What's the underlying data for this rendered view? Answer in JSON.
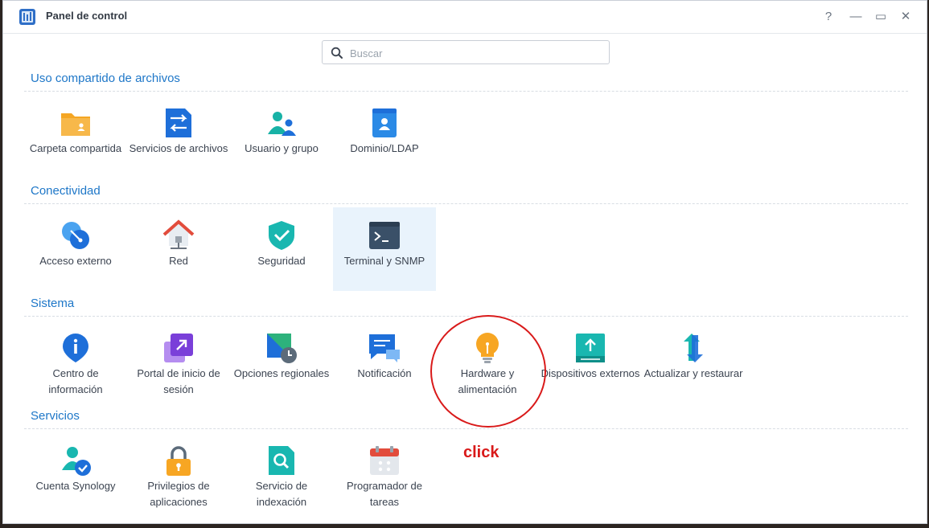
{
  "window": {
    "title": "Panel de control",
    "controls": {
      "help": "?",
      "minimize": "—",
      "maximize": "▭",
      "close": "✕"
    }
  },
  "search": {
    "placeholder": "Buscar",
    "value": ""
  },
  "sections": [
    {
      "title": "Uso compartido de archivos",
      "items": [
        {
          "label": "Carpeta compartida",
          "icon": "shared-folder-icon"
        },
        {
          "label": "Servicios de archivos",
          "icon": "file-services-icon"
        },
        {
          "label": "Usuario y grupo",
          "icon": "user-group-icon"
        },
        {
          "label": "Dominio/LDAP",
          "icon": "domain-ldap-icon"
        }
      ]
    },
    {
      "title": "Conectividad",
      "items": [
        {
          "label": "Acceso externo",
          "icon": "external-access-icon"
        },
        {
          "label": "Red",
          "icon": "network-icon"
        },
        {
          "label": "Seguridad",
          "icon": "security-shield-icon"
        },
        {
          "label": "Terminal y SNMP",
          "icon": "terminal-icon",
          "selected": true
        }
      ]
    },
    {
      "title": "Sistema",
      "items": [
        {
          "label": "Centro de información",
          "icon": "info-center-icon"
        },
        {
          "label": "Portal de inicio de sesión",
          "icon": "login-portal-icon"
        },
        {
          "label": "Opciones regionales",
          "icon": "regional-options-icon"
        },
        {
          "label": "Notificación",
          "icon": "notification-icon"
        },
        {
          "label": "Hardware y alimentación",
          "icon": "hardware-power-bulb-icon"
        },
        {
          "label": "Dispositivos externos",
          "icon": "external-devices-icon"
        },
        {
          "label": "Actualizar y restaurar",
          "icon": "update-restore-icon"
        }
      ]
    },
    {
      "title": "Servicios",
      "items": [
        {
          "label": "Cuenta Synology",
          "icon": "synology-account-icon"
        },
        {
          "label": "Privilegios de aplicaciones",
          "icon": "app-privileges-lock-icon"
        },
        {
          "label": "Servicio de indexación",
          "icon": "indexing-service-icon"
        },
        {
          "label": "Programador de tareas",
          "icon": "task-scheduler-icon"
        }
      ]
    }
  ],
  "annotation": {
    "text": "click",
    "color": "#d91a1a"
  },
  "colors": {
    "accent": "#1e77c8",
    "selected_bg": "#e9f3fc"
  }
}
